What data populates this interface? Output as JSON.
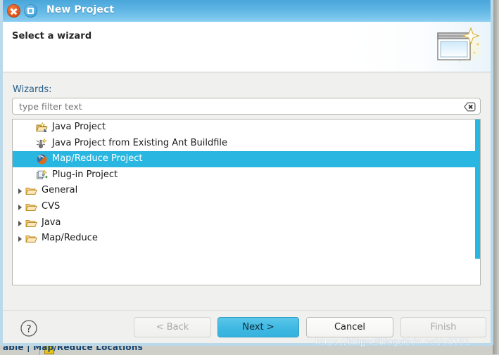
{
  "window": {
    "title": "New Project",
    "close_icon": "close-icon",
    "maximize_icon": "maximize-icon"
  },
  "header": {
    "title": "Select a wizard",
    "graphic_icon": "wizard-sparkle-icon"
  },
  "body": {
    "wizards_label": "Wizards:",
    "filter": {
      "value": "",
      "placeholder": "type filter text",
      "clear_icon": "clear-filter-icon"
    },
    "tree": {
      "items": [
        {
          "label": "Java Project",
          "icon": "java-project-icon",
          "type": "leaf",
          "expandable": false,
          "selected": false
        },
        {
          "label": "Java Project from Existing Ant Buildfile",
          "icon": "ant-buildfile-icon",
          "type": "leaf",
          "expandable": false,
          "selected": false
        },
        {
          "label": "Map/Reduce Project",
          "icon": "map-reduce-project-icon",
          "type": "leaf",
          "expandable": false,
          "selected": true
        },
        {
          "label": "Plug-in Project",
          "icon": "plugin-project-icon",
          "type": "leaf",
          "expandable": false,
          "selected": false
        },
        {
          "label": "General",
          "icon": "folder-icon",
          "type": "category",
          "expandable": true,
          "selected": false
        },
        {
          "label": "CVS",
          "icon": "folder-icon",
          "type": "category",
          "expandable": true,
          "selected": false
        },
        {
          "label": "Java",
          "icon": "folder-icon",
          "type": "category",
          "expandable": true,
          "selected": false
        },
        {
          "label": "Map/Reduce",
          "icon": "folder-icon",
          "type": "category",
          "expandable": true,
          "selected": false
        }
      ]
    }
  },
  "buttons": {
    "help": "?",
    "back": "< Back",
    "next": "Next >",
    "cancel": "Cancel",
    "finish": "Finish"
  },
  "watermark": {
    "line1": "https://blog.csdn.net/",
    "line2": "https://blog.csdn.net/u0161"
  },
  "background": {
    "tab_label": "able |  Map/Reduce Locations"
  },
  "colors": {
    "titlebar": "#5fb6e4",
    "selection": "#29b6e0",
    "primary_button": "#41b9e2",
    "label_blue": "#2a5d86",
    "dialog_border": "#bcd9ea"
  }
}
